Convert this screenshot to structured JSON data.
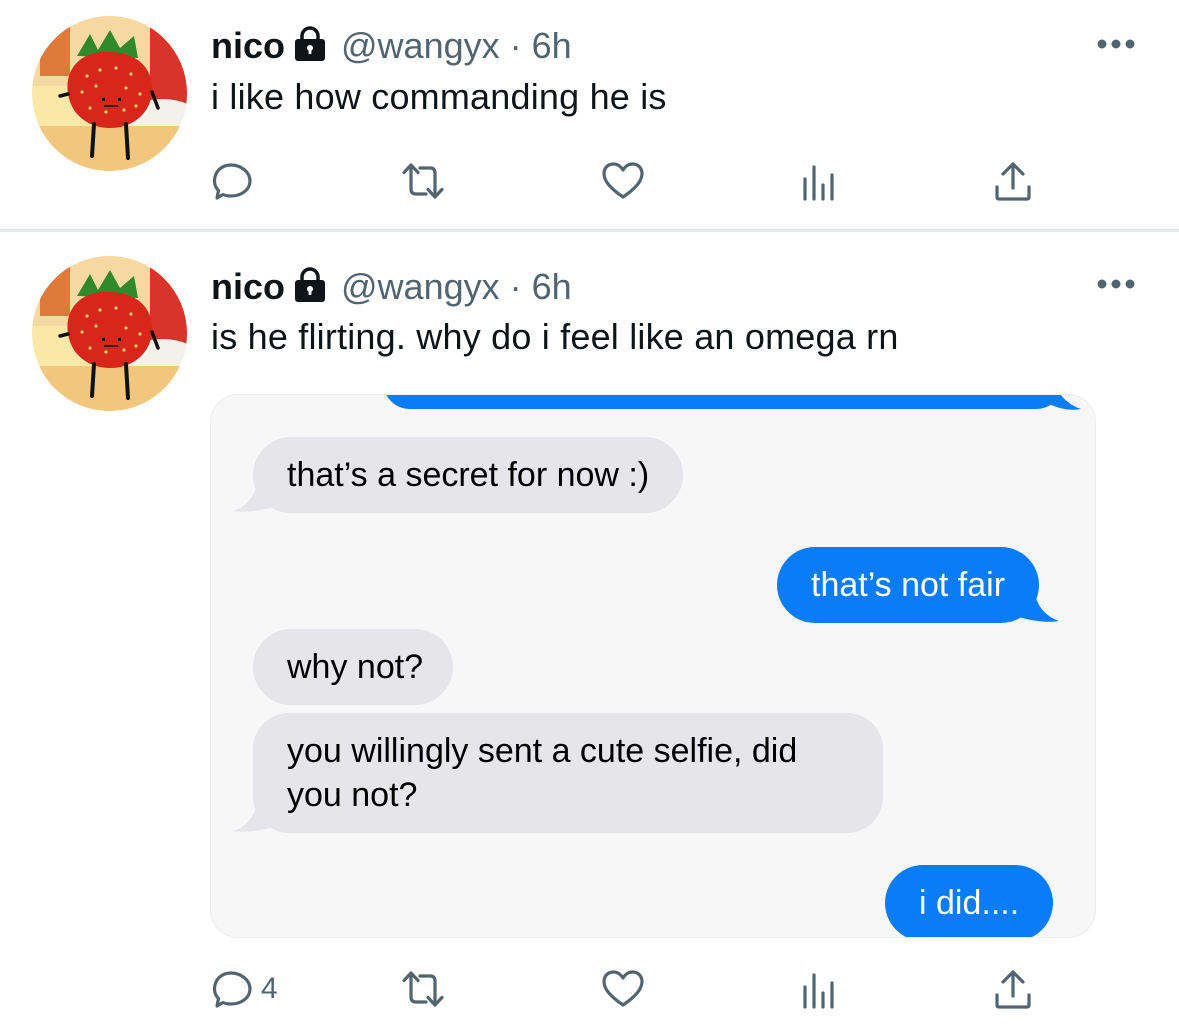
{
  "tweets": [
    {
      "display_name": "nico",
      "handle": "@wangyx",
      "separator": "·",
      "time": "6h",
      "text": "i like how commanding he is",
      "reply_count": ""
    },
    {
      "display_name": "nico",
      "handle": "@wangyx",
      "separator": "·",
      "time": "6h",
      "text": "is he flirting. why do i feel like an omega rn",
      "reply_count": "4",
      "messages": [
        {
          "side": "received",
          "text": "that’s a secret for now :)"
        },
        {
          "side": "sent",
          "text": "that’s not fair"
        },
        {
          "side": "received",
          "text": "why not?"
        },
        {
          "side": "received",
          "text": "you willingly sent a cute selfie, did you not?"
        },
        {
          "side": "sent",
          "text": "i did...."
        }
      ]
    }
  ],
  "icons": {
    "reply": "speech-bubble-icon",
    "retweet": "retweet-icon",
    "like": "heart-icon",
    "views": "bar-chart-icon",
    "share": "share-icon",
    "more": "more-dots-icon",
    "lock": "lock-icon"
  },
  "colors": {
    "text": "#0f1419",
    "secondary": "#536471",
    "imessage_blue": "#0b7cf7",
    "imessage_gray": "#e5e5ea"
  }
}
